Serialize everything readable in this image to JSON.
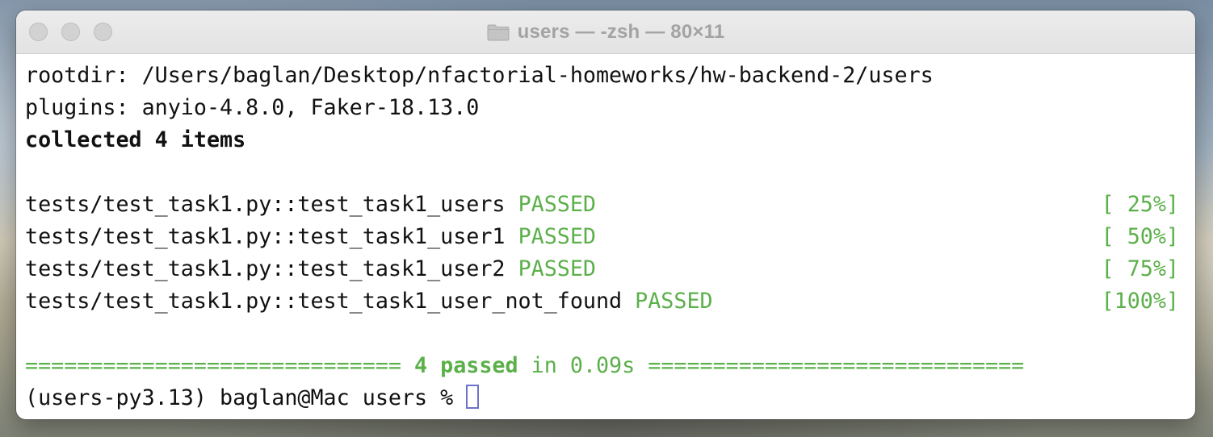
{
  "window": {
    "title": "users — -zsh — 80×11"
  },
  "icons": {
    "title_icon": "folder-icon"
  },
  "colors": {
    "pass_green": "#5bb04a",
    "cursor_outline": "#6c73c9"
  },
  "terminal": {
    "rootdir_line": "rootdir: /Users/baglan/Desktop/nfactorial-homeworks/hw-backend-2/users",
    "plugins_line": "plugins: anyio-4.8.0, Faker-18.13.0",
    "collected_line": "collected 4 items",
    "tests": [
      {
        "name": "tests/test_task1.py::test_task1_users",
        "status": "PASSED",
        "progress": "[ 25%]"
      },
      {
        "name": "tests/test_task1.py::test_task1_user1",
        "status": "PASSED",
        "progress": "[ 50%]"
      },
      {
        "name": "tests/test_task1.py::test_task1_user2",
        "status": "PASSED",
        "progress": "[ 75%]"
      },
      {
        "name": "tests/test_task1.py::test_task1_user_not_found",
        "status": "PASSED",
        "progress": "[100%]"
      }
    ],
    "summary": {
      "left_rule": "=============================",
      "passed_text": "4 passed",
      "time_text": "in 0.09s",
      "right_rule": "============================="
    },
    "prompt": "(users-py3.13) baglan@Mac users % "
  }
}
